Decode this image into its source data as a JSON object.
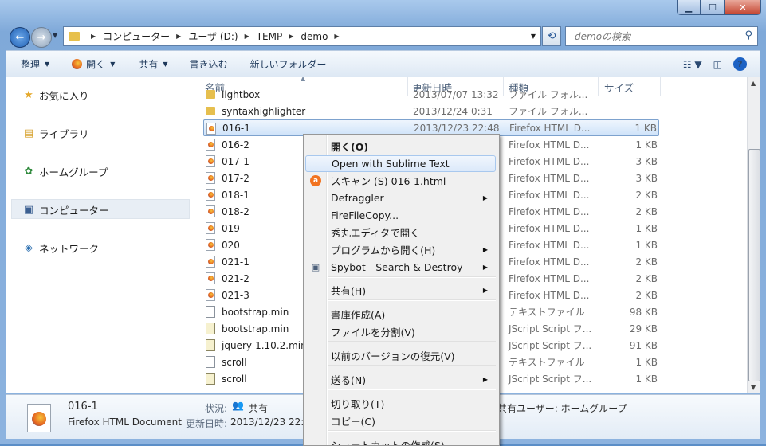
{
  "window": {
    "minimize_symbol": "▁",
    "maximize_symbol": "☐",
    "close_symbol": "✕"
  },
  "address": {
    "crumbs": [
      "コンピューター",
      "ユーザ (D:)",
      "TEMP",
      "demo"
    ]
  },
  "search": {
    "placeholder": "demoの検索"
  },
  "toolbar": {
    "organize": "整理",
    "open": "開く",
    "share": "共有",
    "burn": "書き込む",
    "new_folder": "新しいフォルダー"
  },
  "navpane": {
    "favorites": "お気に入り",
    "libraries": "ライブラリ",
    "homegroup": "ホームグループ",
    "computer": "コンピューター",
    "network": "ネットワーク"
  },
  "columns": {
    "name": "名前",
    "date": "更新日時",
    "type": "種類",
    "size": "サイズ"
  },
  "files": [
    {
      "name": "lightbox",
      "date": "2013/07/07 13:32",
      "type": "ファイル フォル...",
      "size": "",
      "icon": "folder"
    },
    {
      "name": "syntaxhighlighter",
      "date": "2013/12/24 0:31",
      "type": "ファイル フォル...",
      "size": "",
      "icon": "folder"
    },
    {
      "name": "016-1",
      "date": "2013/12/23 22:48",
      "type": "Firefox HTML D...",
      "size": "1 KB",
      "icon": "firefox"
    },
    {
      "name": "016-2",
      "date": "",
      "type": "Firefox HTML D...",
      "size": "1 KB",
      "icon": "firefox"
    },
    {
      "name": "017-1",
      "date": "",
      "type": "Firefox HTML D...",
      "size": "3 KB",
      "icon": "firefox"
    },
    {
      "name": "017-2",
      "date": "",
      "type": "Firefox HTML D...",
      "size": "3 KB",
      "icon": "firefox"
    },
    {
      "name": "018-1",
      "date": "",
      "type": "Firefox HTML D...",
      "size": "2 KB",
      "icon": "firefox"
    },
    {
      "name": "018-2",
      "date": "",
      "type": "Firefox HTML D...",
      "size": "2 KB",
      "icon": "firefox"
    },
    {
      "name": "019",
      "date": "",
      "type": "Firefox HTML D...",
      "size": "1 KB",
      "icon": "firefox"
    },
    {
      "name": "020",
      "date": "",
      "type": "Firefox HTML D...",
      "size": "1 KB",
      "icon": "firefox"
    },
    {
      "name": "021-1",
      "date": "",
      "type": "Firefox HTML D...",
      "size": "2 KB",
      "icon": "firefox"
    },
    {
      "name": "021-2",
      "date": "",
      "type": "Firefox HTML D...",
      "size": "2 KB",
      "icon": "firefox"
    },
    {
      "name": "021-3",
      "date": "",
      "type": "Firefox HTML D...",
      "size": "2 KB",
      "icon": "firefox"
    },
    {
      "name": "bootstrap.min",
      "date": "",
      "type": "テキストファイル",
      "size": "98 KB",
      "icon": "text"
    },
    {
      "name": "bootstrap.min",
      "date": "",
      "type": "JScript Script フ...",
      "size": "29 KB",
      "icon": "script"
    },
    {
      "name": "jquery-1.10.2.min",
      "date": "",
      "type": "JScript Script フ...",
      "size": "91 KB",
      "icon": "script"
    },
    {
      "name": "scroll",
      "date": "",
      "type": "テキストファイル",
      "size": "1 KB",
      "icon": "text"
    },
    {
      "name": "scroll",
      "date": "",
      "type": "JScript Script フ...",
      "size": "1 KB",
      "icon": "script"
    }
  ],
  "details": {
    "name": "016-1",
    "type": "Firefox HTML Document",
    "modified_label": "更新日時:",
    "modified_value": "2013/12/23 22:",
    "status_label": "状況:",
    "status_value": "共有",
    "shared_text": "共有ユーザー: ホームグループ"
  },
  "context_menu": [
    {
      "label": "開く(O)",
      "bold": true
    },
    {
      "label": "Open with Sublime Text",
      "highlight": true
    },
    {
      "label": "スキャン (S) 016-1.html",
      "icon": "avast"
    },
    {
      "label": "Defraggler",
      "submenu": true
    },
    {
      "label": "FireFileCopy..."
    },
    {
      "label": "秀丸エディタで開く"
    },
    {
      "label": "プログラムから開く(H)",
      "submenu": true
    },
    {
      "label": "Spybot - Search & Destroy",
      "submenu": true,
      "icon": "spybot"
    },
    {
      "label": "共有(H)",
      "submenu": true
    },
    {
      "label": "書庫作成(A)"
    },
    {
      "label": "ファイルを分割(V)"
    },
    {
      "label": "以前のバージョンの復元(V)"
    },
    {
      "label": "送る(N)",
      "submenu": true
    },
    {
      "label": "切り取り(T)"
    },
    {
      "label": "コピー(C)"
    },
    {
      "label": "ショートカットの作成(S)"
    }
  ]
}
